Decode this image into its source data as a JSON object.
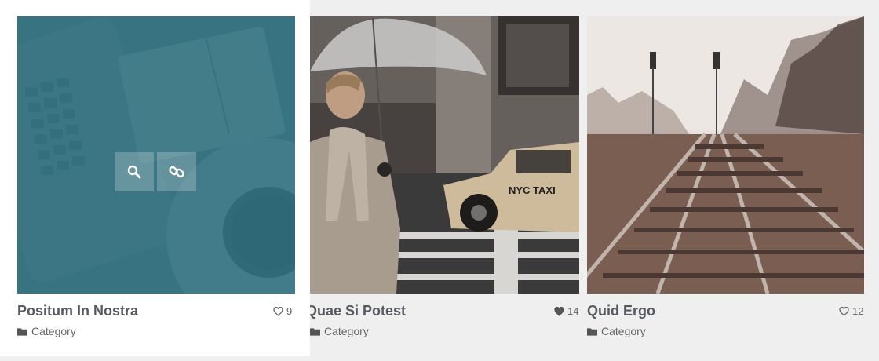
{
  "items": [
    {
      "title": "Positum In Nostra",
      "likes": "9",
      "liked": false,
      "category": "Category",
      "image_desc": "desk-laptop-notebook-coffee"
    },
    {
      "title": "Quae Si Potest",
      "likes": "14",
      "liked": true,
      "category": "Category",
      "image_desc": "woman-umbrella-taxi",
      "taxi_text": "NYC TAXI"
    },
    {
      "title": "Quid Ergo",
      "likes": "12",
      "liked": false,
      "category": "Category",
      "image_desc": "railroad-tracks"
    }
  ],
  "colors": {
    "overlay": "#2f6f7e",
    "title": "#555a5f",
    "meta": "#666666"
  },
  "icons": {
    "zoom": "search-icon",
    "link": "link-icon",
    "heart": "heart-icon",
    "folder": "folder-icon"
  }
}
